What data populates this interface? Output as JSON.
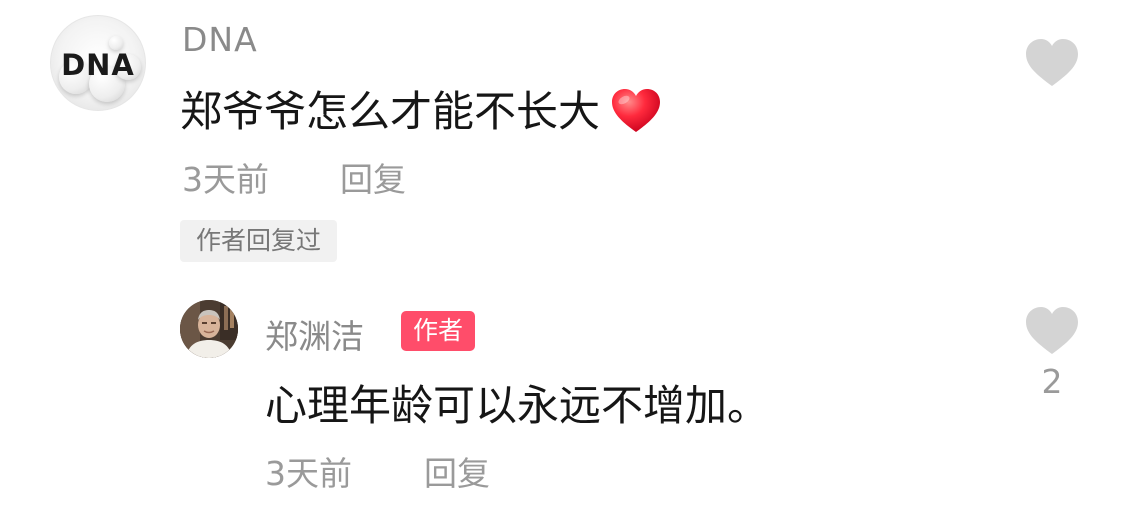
{
  "comment": {
    "username": "DNA",
    "avatar_logo_text": "DNA",
    "text": "郑爷爷怎么才能不长大",
    "emoji": "red-heart-emoji",
    "time": "3天前",
    "reply_label": "回复",
    "author_replied_tag": "作者回复过",
    "like_icon": "heart-icon"
  },
  "reply": {
    "username": "郑渊洁",
    "author_badge": "作者",
    "text": "心理年龄可以永远不增加。",
    "time": "3天前",
    "reply_label": "回复",
    "like_icon": "heart-icon",
    "like_count": "2"
  },
  "colors": {
    "username": "#8a8a8a",
    "text": "#161616",
    "meta": "#9a9a9a",
    "author_badge_bg": "#ff4d6a",
    "like_heart": "#d4d4d4",
    "emoji_heart": "#ff2a3d"
  }
}
